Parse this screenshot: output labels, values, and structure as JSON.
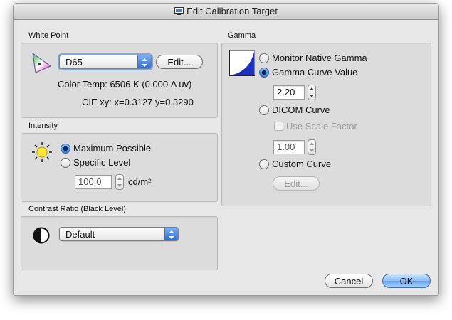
{
  "window": {
    "title": "Edit Calibration Target"
  },
  "white_point": {
    "label": "White Point",
    "popup_value": "D65",
    "edit_button": "Edit...",
    "color_temp": "Color Temp: 6506 K (0.000 Δ uv)",
    "cie_xy": "CIE xy: x=0.3127 y=0.3290"
  },
  "intensity": {
    "label": "Intensity",
    "options": {
      "max": "Maximum Possible",
      "specific": "Specific Level"
    },
    "selected": "max",
    "level_value": "100.0",
    "unit": "cd/m²"
  },
  "contrast": {
    "label": "Contrast Ratio (Black Level)",
    "popup_value": "Default"
  },
  "gamma": {
    "label": "Gamma",
    "options": {
      "native": "Monitor Native Gamma",
      "curve": "Gamma Curve Value",
      "dicom": "DICOM Curve",
      "custom": "Custom Curve"
    },
    "selected": "curve",
    "curve_value": "2.20",
    "use_scale_factor": "Use Scale Factor",
    "scale_value": "1.00",
    "custom_edit": "Edit..."
  },
  "buttons": {
    "cancel": "Cancel",
    "ok": "OK"
  },
  "colors": {
    "accent": "#3b7fde",
    "window_bg": "#e7e7e7",
    "group_bg": "#dcdcdc"
  },
  "icons": [
    "display-icon",
    "color-gamut-icon",
    "sun-icon",
    "contrast-icon",
    "gamma-curve-icon"
  ]
}
